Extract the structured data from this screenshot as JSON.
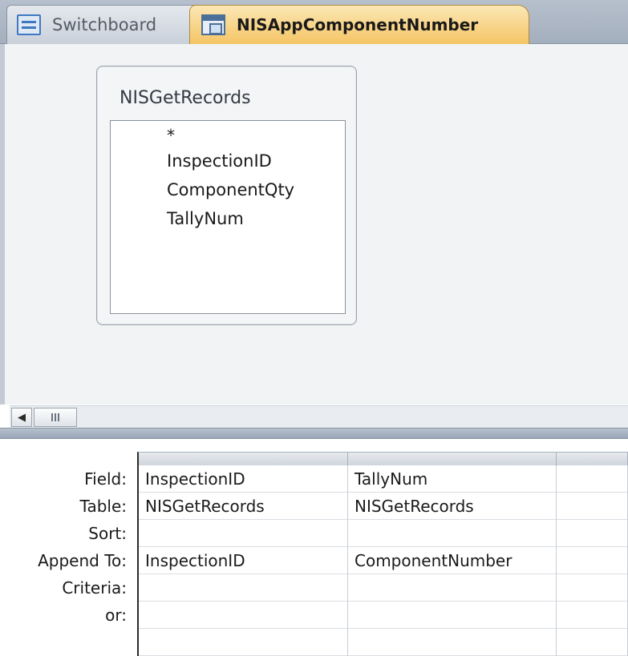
{
  "tabs": [
    {
      "label": "Switchboard",
      "icon": "switchboard-form-icon",
      "active": false
    },
    {
      "label": "NISAppComponentNumber",
      "icon": "append-query-icon",
      "active": true
    }
  ],
  "field_list": {
    "title": "NISGetRecords",
    "fields": [
      "*",
      "InspectionID",
      "ComponentQty",
      "TallyNum"
    ]
  },
  "grid": {
    "row_labels": [
      "Field:",
      "Table:",
      "Sort:",
      "Append To:",
      "Criteria:",
      "or:"
    ],
    "columns": [
      {
        "field": "InspectionID",
        "table": "NISGetRecords",
        "sort": "",
        "append_to": "InspectionID",
        "criteria": "",
        "or": ""
      },
      {
        "field": "TallyNum",
        "table": "NISGetRecords",
        "sort": "",
        "append_to": "ComponentNumber",
        "criteria": "",
        "or": ""
      },
      {
        "field": "",
        "table": "",
        "sort": "",
        "append_to": "",
        "criteria": "",
        "or": ""
      }
    ]
  },
  "colors": {
    "active_tab": "#f5c565",
    "tabstrip": "#aab4c2",
    "design_area": "#f1f3f5"
  }
}
